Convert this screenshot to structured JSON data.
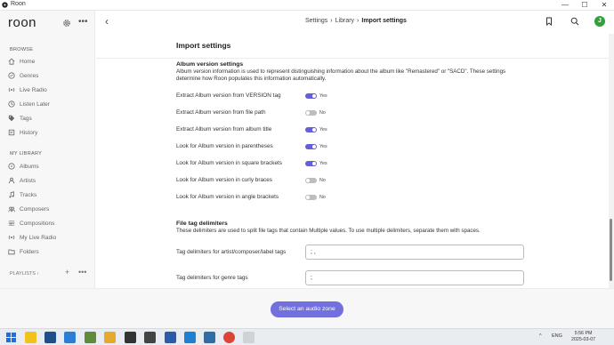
{
  "window": {
    "title": "Roon",
    "minimize": "—",
    "maximize": "☐",
    "close": "✕"
  },
  "sidebar": {
    "logo": "roon",
    "browse_label": "BROWSE",
    "browse_items": [
      {
        "label": "Home",
        "icon": "home-icon"
      },
      {
        "label": "Genres",
        "icon": "genres-icon"
      },
      {
        "label": "Live Radio",
        "icon": "radio-icon"
      },
      {
        "label": "Listen Later",
        "icon": "listen-later-icon"
      },
      {
        "label": "Tags",
        "icon": "tag-icon"
      },
      {
        "label": "History",
        "icon": "history-icon"
      }
    ],
    "library_label": "MY LIBRARY",
    "library_items": [
      {
        "label": "Albums",
        "icon": "album-icon"
      },
      {
        "label": "Artists",
        "icon": "artist-icon"
      },
      {
        "label": "Tracks",
        "icon": "track-icon"
      },
      {
        "label": "Composers",
        "icon": "composer-icon"
      },
      {
        "label": "Compositions",
        "icon": "composition-icon"
      },
      {
        "label": "My Live Radio",
        "icon": "radio-icon"
      },
      {
        "label": "Folders",
        "icon": "folder-icon"
      }
    ],
    "playlists_label": "PLAYLISTS ›",
    "plus": "+",
    "dots": "•••"
  },
  "header": {
    "back": "‹",
    "breadcrumb": [
      "Settings",
      "Library",
      "Import settings"
    ],
    "separator": "›",
    "avatar_letter": "J"
  },
  "main": {
    "page_title": "Import settings",
    "album_version": {
      "title": "Album version settings",
      "description": "Album version information is used to represent distinguishing information about the album like \"Remastered\" or \"SACD\". These settings determine how Roon populates this information automatically.",
      "rows": [
        {
          "label": "Extract Album version from VERSION tag",
          "state": "on",
          "value": "Yes"
        },
        {
          "label": "Extract Album version from file path",
          "state": "off",
          "value": "No"
        },
        {
          "label": "Extract Album version from album title",
          "state": "on",
          "value": "Yes"
        },
        {
          "label": "Look for Album version in parentheses",
          "state": "on",
          "value": "Yes"
        },
        {
          "label": "Look for Album version in square brackets",
          "state": "on",
          "value": "Yes"
        },
        {
          "label": "Look for Album version in curly braces",
          "state": "off",
          "value": "No"
        },
        {
          "label": "Look for Album version in angle brackets",
          "state": "off",
          "value": "No"
        }
      ]
    },
    "delimiters": {
      "title": "File tag delimiters",
      "description": "These delimiters are used to split file tags that contain Multiple values. To use multiple delimiters, separate them with spaces.",
      "fields": [
        {
          "label": "Tag delimiters for artist/composer/label tags",
          "value": "; ,"
        },
        {
          "label": "Tag delimiters for genre tags",
          "value": ";"
        }
      ]
    }
  },
  "bottom": {
    "zone_button": "Select an audio zone"
  },
  "taskbar": {
    "lang": "ENG",
    "time": "5:56 PM",
    "date": "2025-03-07",
    "tray_arrow": "^"
  },
  "colors": {
    "accent": "#6461d6",
    "avatar": "#2fa23b",
    "toggle_off": "#bdbdbd"
  }
}
